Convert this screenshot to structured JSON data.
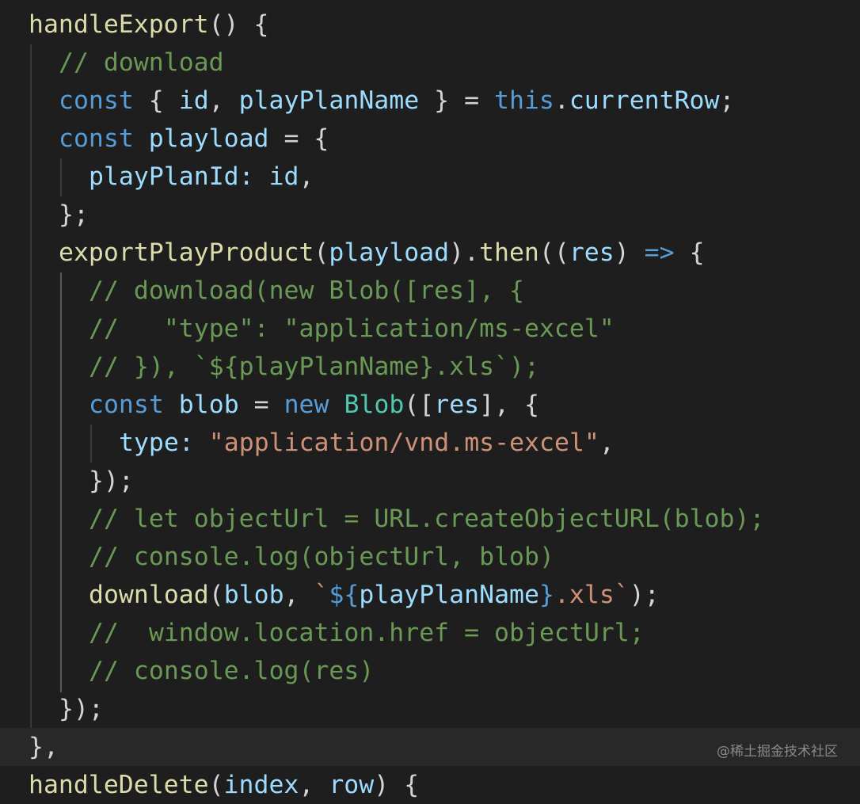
{
  "colors": {
    "background": "#1e1e1e",
    "function": "#dcdcaa",
    "keyword": "#569cd6",
    "variable": "#9cdcfe",
    "class": "#4ec9b0",
    "string": "#ce9178",
    "comment": "#6a9955",
    "punctuation": "#d4d4d4"
  },
  "code_lines": [
    [
      [
        "fn",
        "handleExport"
      ],
      [
        "p",
        "() {"
      ]
    ],
    [
      [
        "com",
        "// download"
      ]
    ],
    [
      [
        "kw",
        "const"
      ],
      [
        "p",
        " { "
      ],
      [
        "var",
        "id"
      ],
      [
        "p",
        ", "
      ],
      [
        "var",
        "playPlanName"
      ],
      [
        "p",
        " } = "
      ],
      [
        "kw",
        "this"
      ],
      [
        "p",
        "."
      ],
      [
        "var",
        "currentRow"
      ],
      [
        "p",
        ";"
      ]
    ],
    [
      [
        "kw",
        "const"
      ],
      [
        "p",
        " "
      ],
      [
        "var",
        "playload"
      ],
      [
        "p",
        " = {"
      ]
    ],
    [
      [
        "var",
        "playPlanId"
      ],
      [
        "var",
        ":"
      ],
      [
        "p",
        " "
      ],
      [
        "var",
        "id"
      ],
      [
        "p",
        ","
      ]
    ],
    [
      [
        "p",
        "};"
      ]
    ],
    [
      [
        "fn",
        "exportPlayProduct"
      ],
      [
        "p",
        "("
      ],
      [
        "var",
        "playload"
      ],
      [
        "p",
        ")."
      ],
      [
        "fn",
        "then"
      ],
      [
        "p",
        "(("
      ],
      [
        "var",
        "res"
      ],
      [
        "p",
        ") "
      ],
      [
        "kw",
        "=>"
      ],
      [
        "p",
        " {"
      ]
    ],
    [
      [
        "com",
        "// download(new Blob([res], {"
      ]
    ],
    [
      [
        "com",
        "//   \"type\": \"application/ms-excel\""
      ]
    ],
    [
      [
        "com",
        "// }), `${playPlanName}.xls`);"
      ]
    ],
    [
      [
        "kw",
        "const"
      ],
      [
        "p",
        " "
      ],
      [
        "var",
        "blob"
      ],
      [
        "p",
        " = "
      ],
      [
        "kw",
        "new"
      ],
      [
        "p",
        " "
      ],
      [
        "cls",
        "Blob"
      ],
      [
        "p",
        "(["
      ],
      [
        "var",
        "res"
      ],
      [
        "p",
        "], {"
      ]
    ],
    [
      [
        "var",
        "type"
      ],
      [
        "var",
        ":"
      ],
      [
        "p",
        " "
      ],
      [
        "str",
        "\"application/vnd.ms-excel\""
      ],
      [
        "p",
        ","
      ]
    ],
    [
      [
        "p",
        "});"
      ]
    ],
    [
      [
        "com",
        "// let objectUrl = URL.createObjectURL(blob);"
      ]
    ],
    [
      [
        "com",
        "// console.log(objectUrl, blob)"
      ]
    ],
    [
      [
        "fn",
        "download"
      ],
      [
        "p",
        "("
      ],
      [
        "var",
        "blob"
      ],
      [
        "p",
        ", "
      ],
      [
        "str",
        "`"
      ],
      [
        "kw",
        "${"
      ],
      [
        "var",
        "playPlanName"
      ],
      [
        "kw",
        "}"
      ],
      [
        "str",
        ".xls`"
      ],
      [
        "p",
        ");"
      ]
    ],
    [
      [
        "com",
        "//  window.location.href = objectUrl;"
      ]
    ],
    [
      [
        "com",
        "// console.log(res)"
      ]
    ],
    [
      [
        "p",
        "});"
      ]
    ],
    [
      [
        "p",
        "},"
      ]
    ],
    [
      [
        "fn",
        "handleDelete"
      ],
      [
        "p",
        "("
      ],
      [
        "var",
        "index"
      ],
      [
        "p",
        ", "
      ],
      [
        "var",
        "row"
      ],
      [
        "p",
        ") {"
      ]
    ]
  ],
  "watermark": "@稀土掘金技术社区"
}
